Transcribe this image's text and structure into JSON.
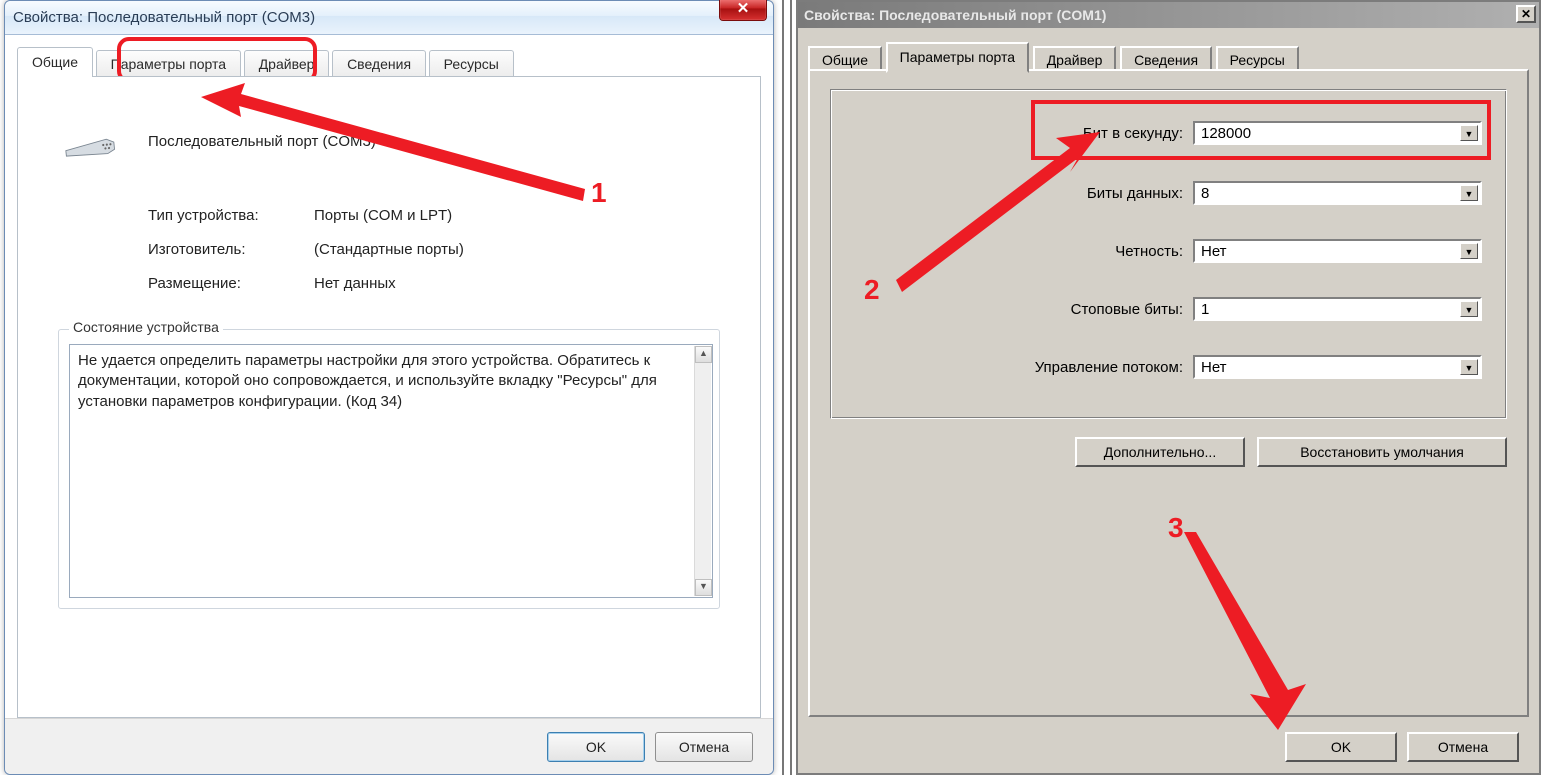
{
  "left_window": {
    "title": "Свойства: Последовательный порт (COM3)",
    "tabs": {
      "general": "Общие",
      "port": "Параметры порта",
      "driver": "Драйвер",
      "details": "Сведения",
      "resources": "Ресурсы"
    },
    "device_name": "Последовательный порт (COM3)",
    "fields": {
      "type_label": "Тип устройства:",
      "type_value": "Порты (COM и LPT)",
      "mfg_label": "Изготовитель:",
      "mfg_value": "(Стандартные порты)",
      "loc_label": "Размещение:",
      "loc_value": "Нет данных"
    },
    "status_group_label": "Состояние устройства",
    "status_text": "Не удается определить параметры настройки для этого устройства. Обратитесь к документации, которой оно сопровождается, и используйте вкладку \"Ресурсы\" для установки параметров конфигурации. (Код 34)",
    "buttons": {
      "ok": "OK",
      "cancel": "Отмена"
    },
    "annotation_number": "1"
  },
  "right_window": {
    "title": "Свойства: Последовательный порт (COM1)",
    "tabs": {
      "general": "Общие",
      "port": "Параметры порта",
      "driver": "Драйвер",
      "details": "Сведения",
      "resources": "Ресурсы"
    },
    "fields": {
      "baud_label": "Бит в секунду:",
      "baud_value": "128000",
      "databits_label": "Биты данных:",
      "databits_value": "8",
      "parity_label": "Четность:",
      "parity_value": "Нет",
      "stopbits_label": "Стоповые биты:",
      "stopbits_value": "1",
      "flow_label": "Управление потоком:",
      "flow_value": "Нет"
    },
    "buttons": {
      "advanced": "Дополнительно...",
      "restore": "Восстановить умолчания",
      "ok": "OK",
      "cancel": "Отмена"
    },
    "annotation_numbers": {
      "two": "2",
      "three": "3"
    }
  }
}
